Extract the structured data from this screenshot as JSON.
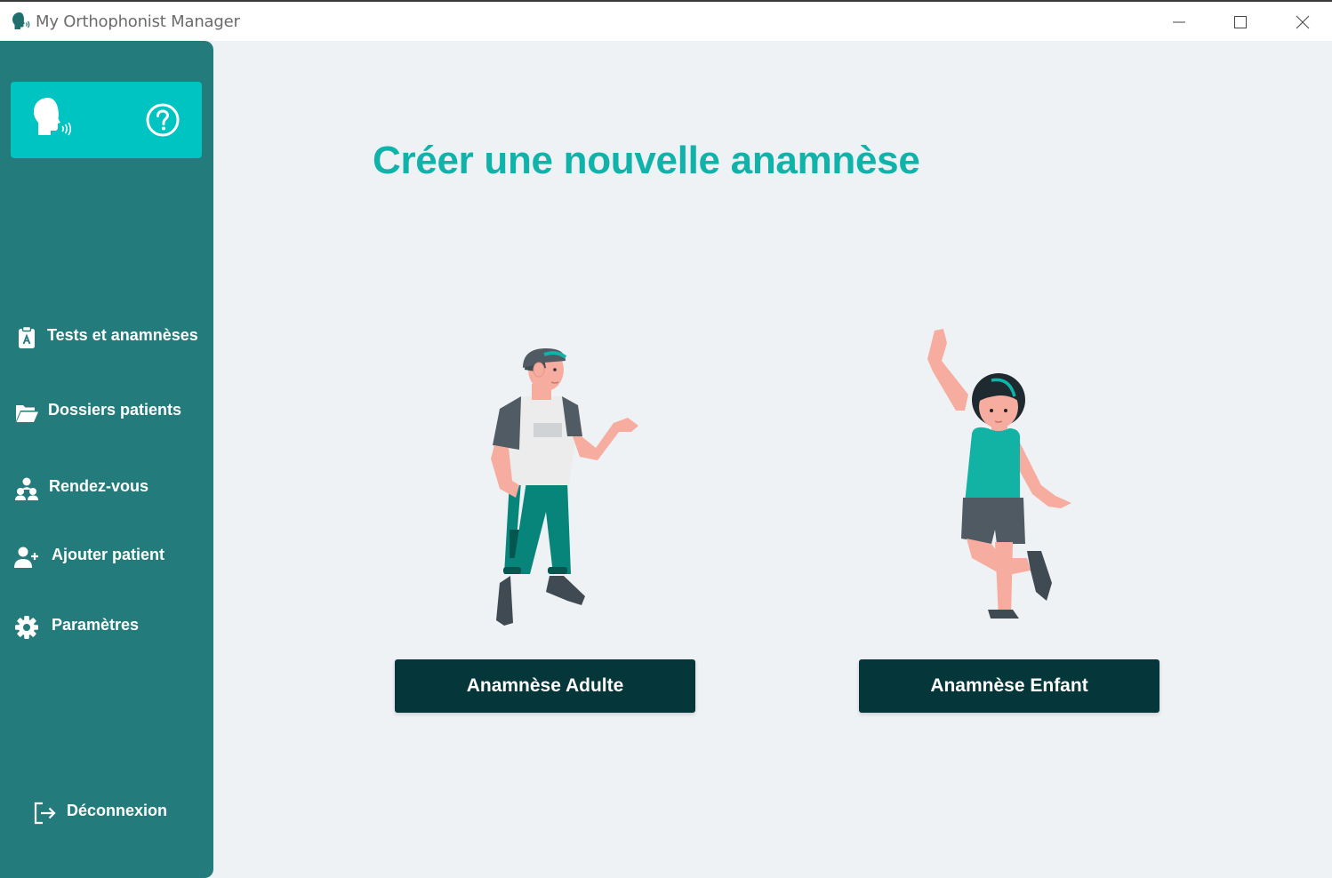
{
  "window": {
    "title": "My Orthophonist Manager",
    "controls": [
      "minimize-icon",
      "maximize-icon",
      "close-icon"
    ]
  },
  "sidebar": {
    "logo_icon": "speaking-head-icon",
    "help_icon": "help-icon",
    "items": [
      {
        "label": "Tests et anamnèses",
        "icon": "clipboard-icon"
      },
      {
        "label": "Dossiers patients",
        "icon": "folder-open-icon"
      },
      {
        "label": "Rendez-vous",
        "icon": "users-icon"
      },
      {
        "label": "Ajouter patient",
        "icon": "user-plus-icon"
      },
      {
        "label": "Paramètres",
        "icon": "gear-icon"
      }
    ],
    "logout": {
      "label": "Déconnexion",
      "icon": "logout-icon"
    }
  },
  "main": {
    "title": "Créer une nouvelle anamnèse",
    "options": [
      {
        "label": "Anamnèse Adulte",
        "illustration": "adult-illustration"
      },
      {
        "label": "Anamnèse Enfant",
        "illustration": "child-illustration"
      }
    ]
  },
  "colors": {
    "sidebar": "#237c7b",
    "logo_card": "#00c4c1",
    "title": "#0fb3a9",
    "button": "#04363a",
    "background": "#eff2f5"
  }
}
